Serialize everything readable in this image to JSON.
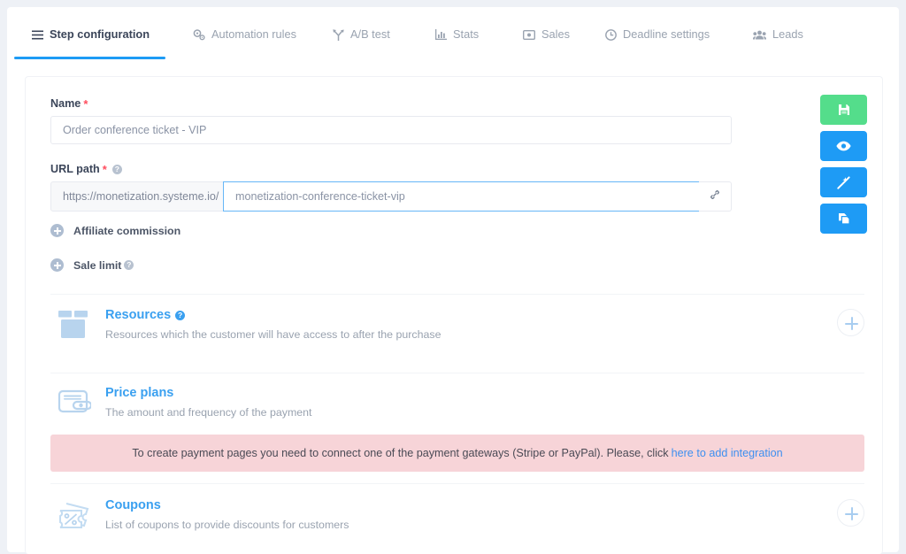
{
  "tabs": [
    {
      "id": "tab-step",
      "label": "Step configuration",
      "icon": "hamburger-icon",
      "active": true
    },
    {
      "id": "tab-auto",
      "label": "Automation rules",
      "icon": "gears-icon",
      "active": false
    },
    {
      "id": "tab-ab",
      "label": "A/B test",
      "icon": "split-arrow-icon",
      "active": false
    },
    {
      "id": "tab-stats",
      "label": "Stats",
      "icon": "bar-chart-icon",
      "active": false
    },
    {
      "id": "tab-sales",
      "label": "Sales",
      "icon": "money-bill-icon",
      "active": false
    },
    {
      "id": "tab-deadline",
      "label": "Deadline settings",
      "icon": "clock-icon",
      "active": false
    },
    {
      "id": "tab-leads",
      "label": "Leads",
      "icon": "users-icon",
      "active": false
    }
  ],
  "form": {
    "name": {
      "label": "Name",
      "required_marker": "*",
      "value": "Order conference ticket - VIP",
      "placeholder": "Order conference ticket - VIP"
    },
    "url_path": {
      "label": "URL path",
      "required_marker": "*",
      "help_glyph": "?",
      "prefix": "https://monetization.systeme.io/",
      "value": "monetization-conference-ticket-vip",
      "placeholder": "monetization-conference-ticket-vip",
      "link_icon": "chain-link-icon"
    },
    "collapsibles": [
      {
        "label": "Affiliate commission",
        "has_help": false,
        "icon": "plus-circle-icon"
      },
      {
        "label": "Sale limit",
        "has_help": true,
        "help_glyph": "?",
        "icon": "plus-circle-icon"
      }
    ]
  },
  "sections": {
    "resources": {
      "title": "Resources",
      "help_glyph": "?",
      "description": "Resources which the customer will have access to after the purchase",
      "icon": "open-box-icon",
      "add_icon": "plus-circle-outline-icon"
    },
    "price_plans": {
      "title": "Price plans",
      "description": "The amount and frequency of the payment",
      "icon": "wallet-icon"
    },
    "coupons": {
      "title": "Coupons",
      "description": "List of coupons to provide discounts for customers",
      "icon": "coupon-percent-icon",
      "add_icon": "plus-circle-outline-icon"
    }
  },
  "warning": {
    "text": "To create payment pages you need to connect one of the payment gateways (Stripe or PayPal). Please, click",
    "link_text": "here to add integration"
  },
  "actions": [
    {
      "name": "save-button",
      "icon": "floppy-disk-icon",
      "color": "#54dd8b"
    },
    {
      "name": "preview-button",
      "icon": "eye-icon",
      "color": "#1e9bf5"
    },
    {
      "name": "edit-page-button",
      "icon": "magic-wand-icon",
      "color": "#1e9bf5"
    },
    {
      "name": "duplicate-button",
      "icon": "copy-icon",
      "color": "#1e9bf5"
    }
  ],
  "colors": {
    "page_bg": "#eef1f6",
    "accent_blue": "#1e9bf5",
    "link_blue": "#3aa0f0",
    "save_green": "#54dd8b",
    "warn_bg": "#f7d4d8",
    "required_red": "#ff4d5e"
  }
}
